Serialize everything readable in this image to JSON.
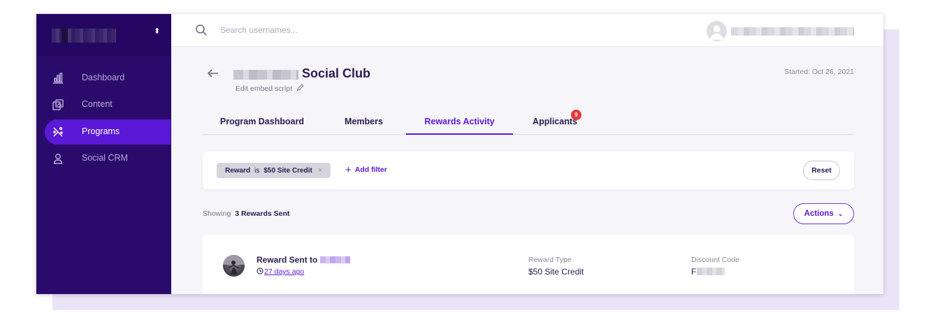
{
  "sidebar": {
    "items": [
      {
        "label": "Dashboard",
        "icon": "bar-chart-icon"
      },
      {
        "label": "Content",
        "icon": "content-icon"
      },
      {
        "label": "Programs",
        "icon": "programs-icon",
        "active": true
      },
      {
        "label": "Social CRM",
        "icon": "person-icon"
      }
    ]
  },
  "header": {
    "search_placeholder": "Search usernames..."
  },
  "program": {
    "title": "Social Club",
    "edit_link": "Edit embed script",
    "started": "Started: Oct 26, 2021"
  },
  "tabs": [
    {
      "label": "Program Dashboard"
    },
    {
      "label": "Members"
    },
    {
      "label": "Rewards Activity",
      "active": true
    },
    {
      "label": "Applicants",
      "badge": "9"
    }
  ],
  "filter": {
    "chip_field": "Reward",
    "chip_op": "is",
    "chip_value": "$50 Site Credit",
    "add_label": "Add filter",
    "reset_label": "Reset"
  },
  "results": {
    "showing_label": "Showing",
    "count_label": "3 Rewards Sent",
    "actions_label": "Actions"
  },
  "reward": {
    "title": "Reward Sent to",
    "time": "27 days ago",
    "type_label": "Reward Type",
    "type_value": "$50 Site Credit",
    "code_label": "Discount Code",
    "code_value": "F"
  },
  "colors": {
    "sidebar_bg": "#2a0a6b",
    "accent": "#5b18d6",
    "badge": "#e5383b",
    "page_bg": "#f6f5fa"
  }
}
